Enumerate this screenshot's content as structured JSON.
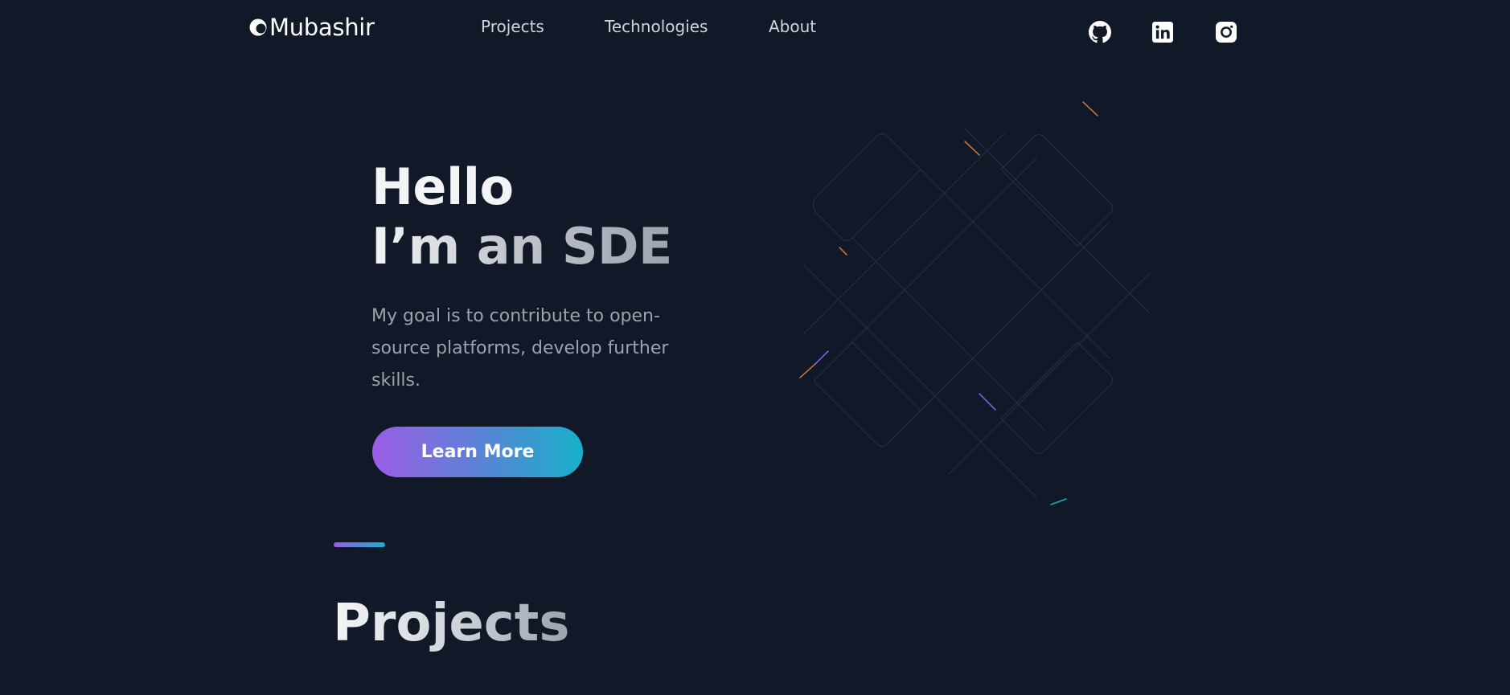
{
  "header": {
    "logo_text": "Mubashir",
    "nav": {
      "projects": "Projects",
      "technologies": "Technologies",
      "about": "About"
    },
    "social_icons": [
      "github-icon",
      "linkedin-icon",
      "instagram-icon"
    ]
  },
  "hero": {
    "line1": "Hello",
    "line2": "I’m an SDE",
    "description": "My goal is to contribute to open-source platforms, develop further skills.",
    "cta_label": "Learn More"
  },
  "projects_section": {
    "title": "Projects"
  },
  "colors": {
    "background": "#111827",
    "gradient_start": "#9b5de5",
    "gradient_end": "#17b0c9",
    "text_primary": "#f3f4f6",
    "text_secondary": "#9ca3af"
  }
}
